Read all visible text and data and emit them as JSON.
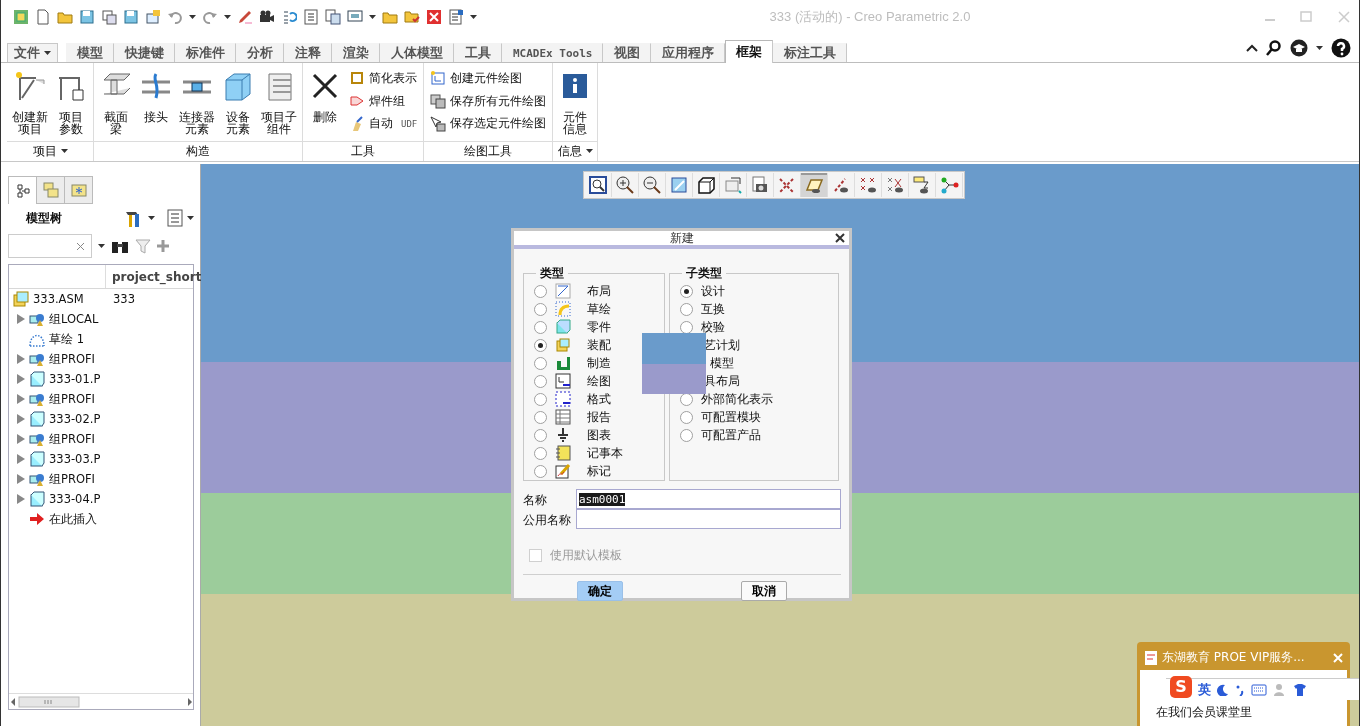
{
  "window": {
    "title": "333 (活动的) - Creo Parametric 2.0"
  },
  "ribbon_tabs": [
    {
      "label": "文件",
      "kind": "menu"
    },
    {
      "label": "模型",
      "selected": false,
      "kind": "tab"
    },
    {
      "label": "快捷键",
      "selected": false,
      "kind": "tab"
    },
    {
      "label": "标准件",
      "selected": false,
      "kind": "tab"
    },
    {
      "label": "分析",
      "selected": false,
      "kind": "tab"
    },
    {
      "label": "注释",
      "selected": false,
      "kind": "tab"
    },
    {
      "label": "渲染",
      "selected": false,
      "kind": "tab"
    },
    {
      "label": "人体模型",
      "selected": false,
      "kind": "tab"
    },
    {
      "label": "工具",
      "selected": false,
      "kind": "tab"
    },
    {
      "label": "MCADEx Tools",
      "selected": false,
      "kind": "tab"
    },
    {
      "label": "视图",
      "selected": false,
      "kind": "tab"
    },
    {
      "label": "应用程序",
      "selected": false,
      "kind": "tab"
    },
    {
      "label": "框架",
      "selected": true,
      "kind": "tab"
    },
    {
      "label": "标注工具",
      "selected": false,
      "kind": "tab"
    }
  ],
  "ribbon_groups": [
    {
      "label": "项目",
      "dropdown": true,
      "large": [
        {
          "lines": [
            "创建新",
            "项目"
          ]
        },
        {
          "lines": [
            "项目",
            "参数"
          ]
        }
      ]
    },
    {
      "label": "构造",
      "dropdown": false,
      "large": [
        {
          "lines": [
            "截面",
            "梁"
          ]
        },
        {
          "lines": [
            "接头"
          ]
        },
        {
          "lines": [
            "连接器",
            "元素"
          ]
        },
        {
          "lines": [
            "设备",
            "元素"
          ]
        },
        {
          "lines": [
            "项目子",
            "组件"
          ]
        }
      ]
    },
    {
      "label": "工具",
      "dropdown": false,
      "large": [
        {
          "lines": [
            "删除"
          ]
        }
      ],
      "small": [
        {
          "label": "简化表示"
        },
        {
          "label": "焊件组"
        },
        {
          "label": "自动",
          "suffix": "UDF"
        }
      ]
    },
    {
      "label": "绘图工具",
      "dropdown": false,
      "small": [
        {
          "label": "创建元件绘图"
        },
        {
          "label": "保存所有元件绘图"
        },
        {
          "label": "保存选定元件绘图"
        }
      ]
    },
    {
      "label": "信息",
      "dropdown": true,
      "large": [
        {
          "lines": [
            "元件",
            "信息"
          ]
        }
      ]
    }
  ],
  "navigator_tabs": [
    {
      "selected": true
    },
    {
      "selected": false
    },
    {
      "selected": false
    }
  ],
  "model_tree": {
    "title": "模型树",
    "column": "project_short",
    "rows": [
      {
        "label": "333.ASM",
        "value": "333",
        "kind": "assembly",
        "expandable": false,
        "children": [
          {
            "label": "组LOCAL",
            "kind": "group",
            "expandable": true
          },
          {
            "label": "草绘 1",
            "kind": "sketch",
            "expandable": false
          },
          {
            "label": "组PROFI",
            "kind": "group",
            "expandable": true
          },
          {
            "label": "333-01.P",
            "kind": "part",
            "expandable": true
          },
          {
            "label": "组PROFI",
            "kind": "group",
            "expandable": true
          },
          {
            "label": "333-02.P",
            "kind": "part",
            "expandable": true
          },
          {
            "label": "组PROFI",
            "kind": "group",
            "expandable": true
          },
          {
            "label": "333-03.P",
            "kind": "part",
            "expandable": true
          },
          {
            "label": "组PROFI",
            "kind": "group",
            "expandable": true
          },
          {
            "label": "333-04.P",
            "kind": "part",
            "expandable": true
          },
          {
            "label": "在此插入",
            "kind": "insert",
            "expandable": false
          }
        ]
      }
    ]
  },
  "view_toolbar": [
    {
      "pressed": false
    },
    {
      "pressed": false
    },
    {
      "pressed": false
    },
    {
      "pressed": false
    },
    {
      "pressed": false
    },
    {
      "pressed": false
    },
    {
      "pressed": false
    },
    {
      "pressed": false
    },
    {
      "pressed": true
    },
    {
      "pressed": false
    },
    {
      "pressed": false
    },
    {
      "pressed": false
    },
    {
      "pressed": false
    },
    {
      "pressed": false
    }
  ],
  "new_dialog": {
    "title": "新建",
    "type_legend": "类型",
    "types": [
      {
        "label": "布局",
        "selected": false
      },
      {
        "label": "草绘",
        "selected": false
      },
      {
        "label": "零件",
        "selected": false
      },
      {
        "label": "装配",
        "selected": true
      },
      {
        "label": "制造",
        "selected": false
      },
      {
        "label": "绘图",
        "selected": false
      },
      {
        "label": "格式",
        "selected": false
      },
      {
        "label": "报告",
        "selected": false
      },
      {
        "label": "图表",
        "selected": false
      },
      {
        "label": "记事本",
        "selected": false
      },
      {
        "label": "标记",
        "selected": false
      }
    ],
    "subtype_legend": "子类型",
    "subtypes": [
      {
        "label": "设计",
        "selected": true,
        "kind": "option"
      },
      {
        "label": "互换",
        "selected": false,
        "kind": "option"
      },
      {
        "label": "校验",
        "selected": false,
        "kind": "option"
      },
      {
        "label": "艺计划",
        "kind": "covered"
      },
      {
        "label": "模型",
        "kind": "covered"
      },
      {
        "label": "具布局",
        "kind": "covered"
      },
      {
        "label": "外部简化表示",
        "selected": false,
        "kind": "option"
      },
      {
        "label": "可配置模块",
        "selected": false,
        "kind": "option"
      },
      {
        "label": "可配置产品",
        "selected": false,
        "kind": "option"
      }
    ],
    "name": {
      "label": "名称",
      "value": "asm0001",
      "value_selected": true
    },
    "common_name": {
      "label": "公用名称"
    },
    "use_template": {
      "label": "使用默认模板",
      "checked": false,
      "disabled": true
    },
    "buttons": [
      {
        "label": "确定",
        "default": true
      },
      {
        "label": "取消",
        "default": false
      }
    ]
  },
  "notification": {
    "title": "东湖教育 PROE VIP服务...",
    "ime_logo": "S",
    "ime_mode": "英",
    "message": "在我们会员课堂里"
  }
}
